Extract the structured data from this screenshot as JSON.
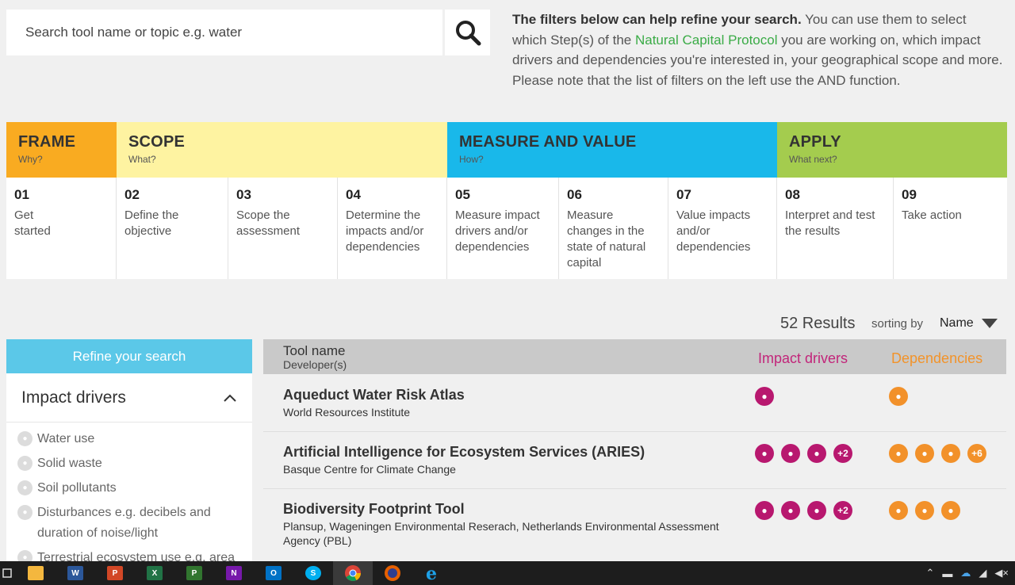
{
  "search": {
    "placeholder": "Search tool name or topic e.g. water"
  },
  "intro": {
    "bold": "The filters below can help refine your search.",
    "text1": " You can use them to select which Step(s) of the ",
    "link": "Natural Capital Protocol",
    "text2": " you are working on, which impact drivers and dependencies you're interested in, your geographical scope and more. Please note that the list of filters on the left use the AND function."
  },
  "stages": [
    {
      "title": "FRAME",
      "sub": "Why?",
      "color": "#f9ab21"
    },
    {
      "title": "SCOPE",
      "sub": "What?",
      "color": "#fef3a1"
    },
    {
      "title": "MEASURE AND VALUE",
      "sub": "How?",
      "color": "#19b8ea"
    },
    {
      "title": "APPLY",
      "sub": "What next?",
      "color": "#a4cc4e"
    }
  ],
  "steps": [
    {
      "num": "01",
      "label": "Get started"
    },
    {
      "num": "02",
      "label": "Define the objective"
    },
    {
      "num": "03",
      "label": "Scope the assessment"
    },
    {
      "num": "04",
      "label": "Determine the impacts and/or dependencies"
    },
    {
      "num": "05",
      "label": "Measure impact drivers and/or dependencies"
    },
    {
      "num": "06",
      "label": "Measure changes in the state of natural capital"
    },
    {
      "num": "07",
      "label": "Value impacts and/or dependencies"
    },
    {
      "num": "08",
      "label": "Interpret and test the results"
    },
    {
      "num": "09",
      "label": "Take action"
    }
  ],
  "results": {
    "count": "52 Results",
    "sorting_label": "sorting by",
    "sort_value": "Name"
  },
  "sidebar": {
    "refine": "Refine your search",
    "section": "Impact drivers",
    "items": [
      "Water use",
      "Solid waste",
      "Soil pollutants",
      "Disturbances e.g. decibels and duration of noise/light",
      "Terrestrial ecosystem use e.g. area"
    ]
  },
  "table": {
    "col_name": "Tool name",
    "col_dev": "Developer(s)",
    "col_impact": "Impact drivers",
    "col_dep": "Dependencies",
    "rows": [
      {
        "name": "Aqueduct Water Risk Atlas",
        "dev": "World Resources Institute",
        "impact_icons": [
          "water-drop-icon"
        ],
        "dep_icons": [
          "water-drop-icon"
        ]
      },
      {
        "name": "Artificial Intelligence for Ecosystem Services (ARIES)",
        "dev": "Basque Centre for Climate Change",
        "impact_icons": [
          "water-drop-icon",
          "tree-icon",
          "soil-icon"
        ],
        "impact_more": "+2",
        "dep_icons": [
          "tree-icon",
          "water-drop-icon",
          "flower-icon"
        ],
        "dep_more": "+6"
      },
      {
        "name": "Biodiversity Footprint Tool",
        "dev": "Plansup, Wageningen Environmental Reserach, Netherlands Environmental Assessment Agency (PBL)",
        "impact_icons": [
          "tree-icon",
          "fishbowl-icon",
          "speaker-icon"
        ],
        "impact_more": "+2",
        "dep_icons": [
          "fire-icon",
          "basket-icon",
          "bird-icon"
        ]
      }
    ]
  },
  "colors": {
    "impact": "#b8186f",
    "dependency": "#f2912a",
    "refine": "#5bc8e8",
    "link": "#3aab46"
  },
  "taskbar": {
    "apps": [
      "task-view",
      "file-explorer",
      "word",
      "powerpoint",
      "excel",
      "project",
      "onenote",
      "outlook",
      "skype",
      "chrome",
      "firefox",
      "edge"
    ],
    "letters": {
      "word": "W",
      "powerpoint": "P",
      "excel": "X",
      "project": "P",
      "onenote": "N",
      "outlook": "O",
      "skype": "S"
    }
  }
}
